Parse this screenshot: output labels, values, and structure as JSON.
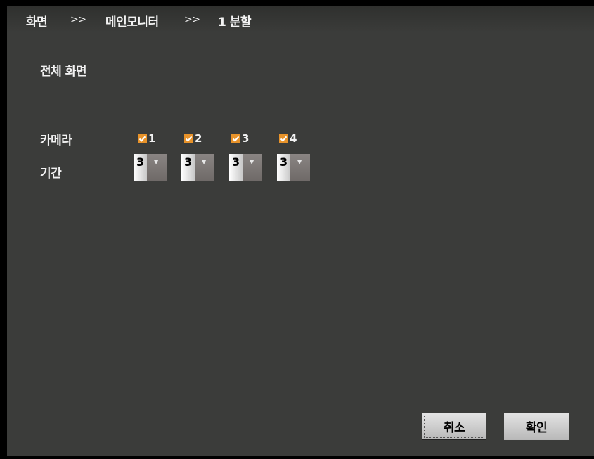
{
  "breadcrumb": {
    "items": [
      "화면",
      "메인모니터",
      "1 분할"
    ],
    "separator": ">>"
  },
  "section_title": "전체 화면",
  "camera": {
    "label": "카메라",
    "options": [
      {
        "label": "1",
        "checked": true
      },
      {
        "label": "2",
        "checked": true
      },
      {
        "label": "3",
        "checked": true
      },
      {
        "label": "4",
        "checked": true
      }
    ]
  },
  "duration": {
    "label": "기간",
    "values": [
      "3",
      "3",
      "3",
      "3"
    ]
  },
  "buttons": {
    "cancel": "취소",
    "ok": "확인"
  },
  "colors": {
    "panel_bg": "#3b3c3a",
    "checkbox_accent": "#e8932a",
    "text": "#f2f2f2"
  }
}
